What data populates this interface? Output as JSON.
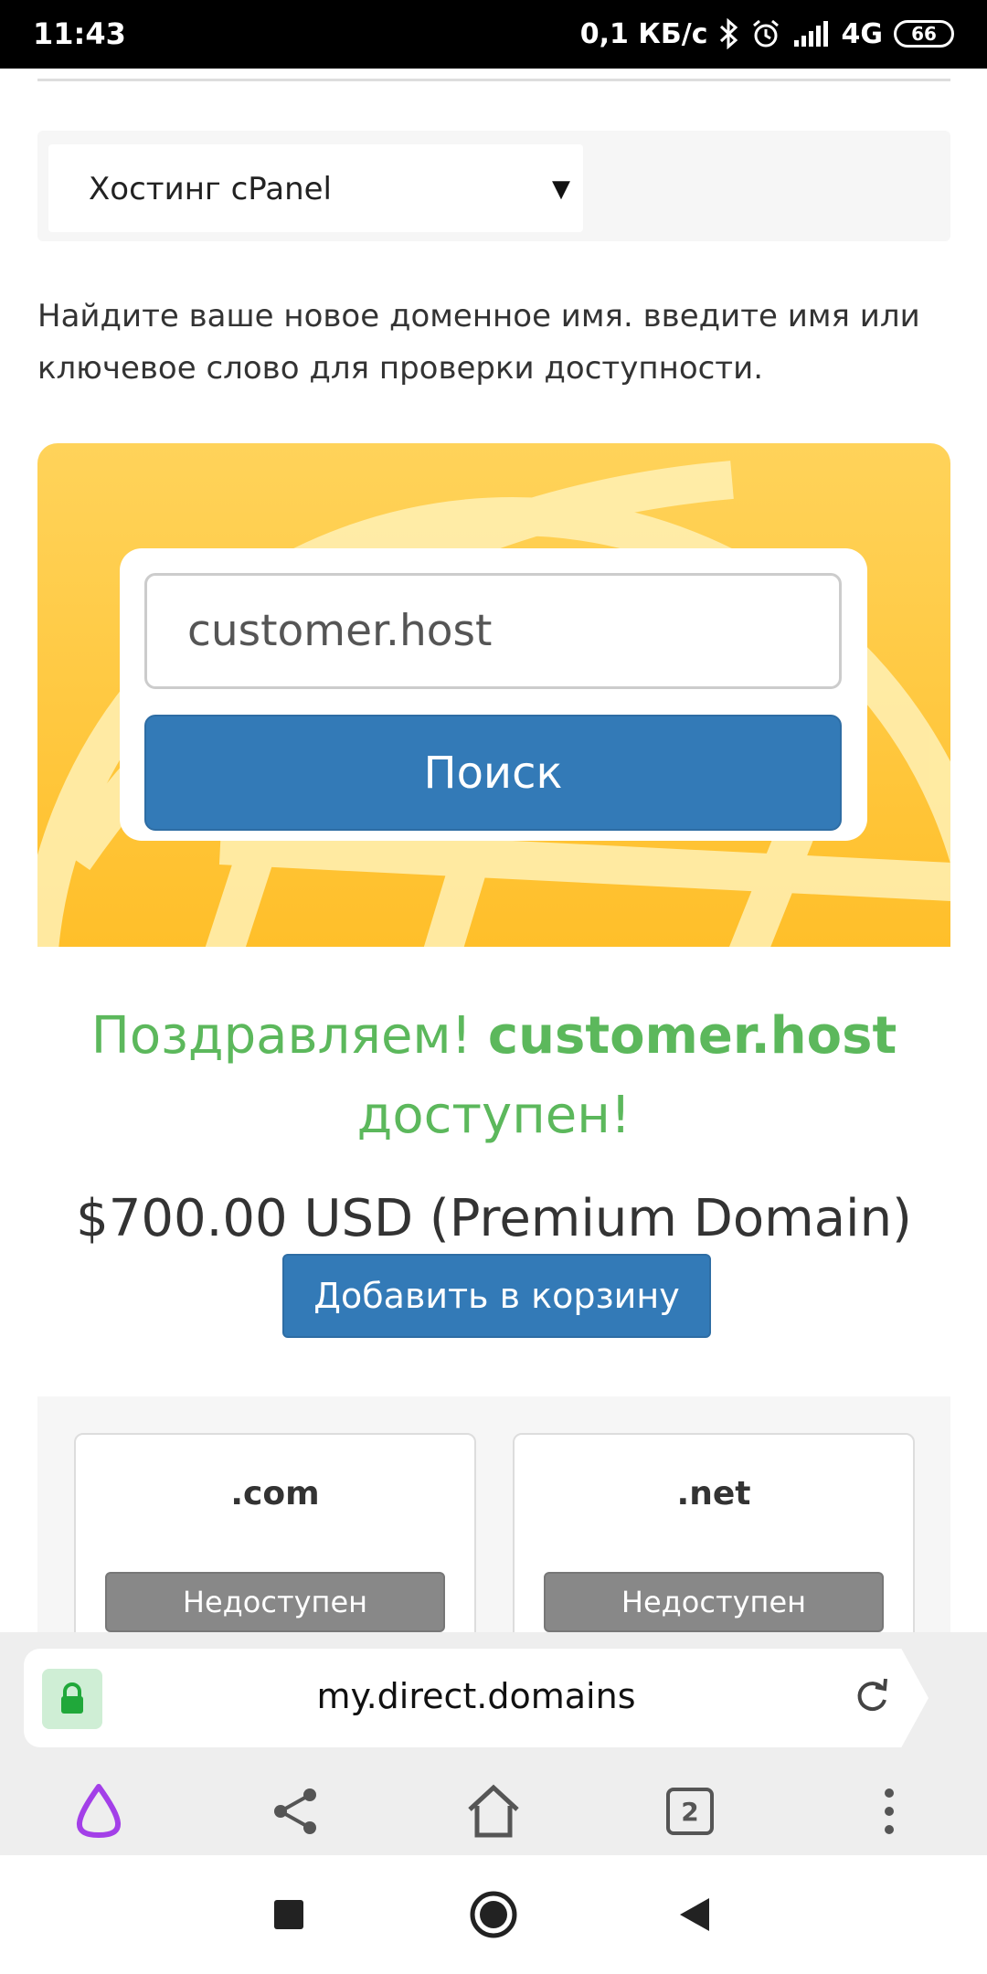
{
  "status_bar": {
    "time": "11:43",
    "network_speed": "0,1 КБ/с",
    "network_type": "4G",
    "battery": "66",
    "icons": [
      "bluetooth-icon",
      "alarm-icon",
      "signal-icon"
    ]
  },
  "hosting_select": {
    "selected": "Хостинг cPanel"
  },
  "intro_text": "Найдите ваше новое доменное имя. введите имя или ключевое слово для проверки доступности.",
  "search": {
    "value": "customer.host",
    "button_label": "Поиск"
  },
  "result": {
    "congrats": "Поздравляем!",
    "domain": "customer.host",
    "available": "доступен!",
    "price": "$700.00 USD (Premium Domain)",
    "add_to_cart_label": "Добавить в корзину"
  },
  "tlds": [
    {
      "name": ".com",
      "status": "Недоступен"
    },
    {
      "name": ".net",
      "status": "Недоступен"
    }
  ],
  "browser": {
    "url": "my.direct.domains",
    "tabs_count": "2"
  },
  "colors": {
    "primary": "#337ab7",
    "success": "#5cb85c",
    "hero": "#ffc83a",
    "assistant": "#a33fe8"
  }
}
